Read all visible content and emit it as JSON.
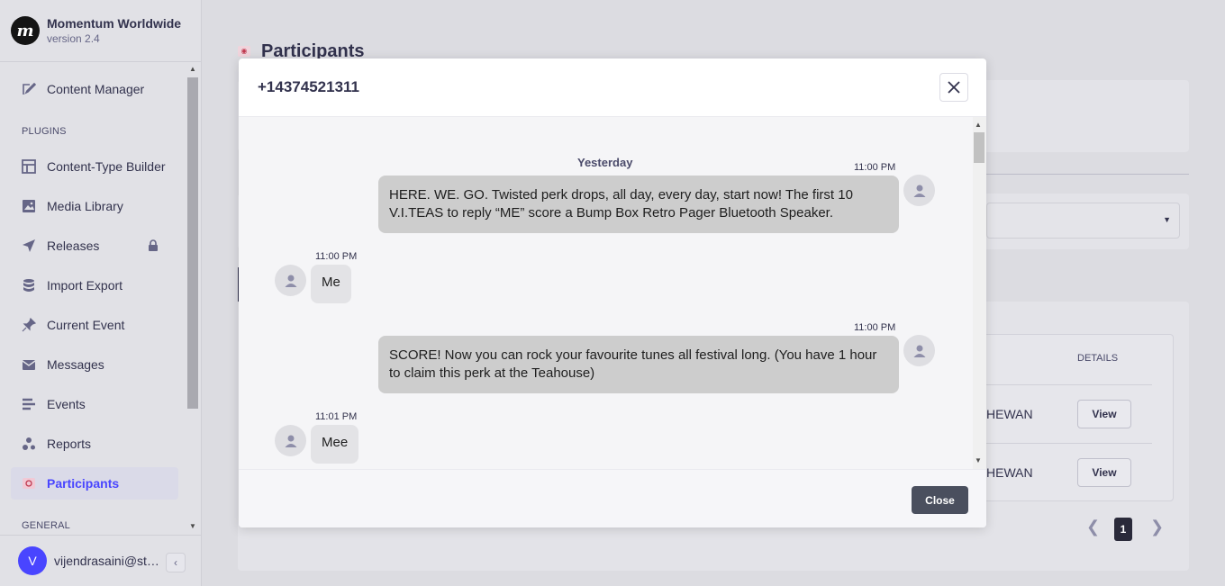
{
  "brand": {
    "name": "Momentum Worldwide",
    "version": "version 2.4",
    "logo_letter": "m"
  },
  "sidebar": {
    "sections": {
      "plugins": "PLUGINS",
      "general": "GENERAL"
    },
    "items": [
      {
        "label": "Content Manager",
        "icon": "feather-icon"
      },
      {
        "label": "Content-Type Builder",
        "icon": "layout-icon"
      },
      {
        "label": "Media Library",
        "icon": "image-icon"
      },
      {
        "label": "Releases",
        "icon": "paper-plane-icon"
      },
      {
        "label": "Import Export",
        "icon": "database-icon"
      },
      {
        "label": "Current Event",
        "icon": "pin-icon"
      },
      {
        "label": "Messages",
        "icon": "envelope-icon"
      },
      {
        "label": "Events",
        "icon": "list-icon"
      },
      {
        "label": "Reports",
        "icon": "reports-icon"
      },
      {
        "label": "Participants",
        "icon": "participants-icon"
      }
    ],
    "user": {
      "initial": "V",
      "name": "vijendrasaini@sta..."
    }
  },
  "page": {
    "title": "Participants",
    "table": {
      "details_header": "DETAILS",
      "rows": [
        {
          "region": "HEWAN",
          "action": "View"
        },
        {
          "region": "HEWAN",
          "action": "View"
        }
      ]
    },
    "pagination": {
      "current": "1"
    }
  },
  "modal": {
    "title": "+14374521311",
    "day_label": "Yesterday",
    "messages": [
      {
        "direction": "out",
        "time": "11:00 PM",
        "text": "HERE. WE. GO. Twisted perk drops, all day, every day, start now! The first 10 V.I.TEAS to reply “ME” score a Bump Box Retro Pager Bluetooth Speaker."
      },
      {
        "direction": "in",
        "time": "11:00 PM",
        "text": "Me"
      },
      {
        "direction": "out",
        "time": "11:00 PM",
        "text": "SCORE! Now you can rock your favourite tunes all festival long. (You have 1 hour to claim this perk at the Teahouse)"
      },
      {
        "direction": "in",
        "time": "11:01 PM",
        "text": "Mee"
      }
    ],
    "close_label": "Close"
  },
  "colors": {
    "accent": "#4945ff",
    "close_button": "#4a4f5e",
    "outgoing_bubble": "#cdcdcd"
  }
}
